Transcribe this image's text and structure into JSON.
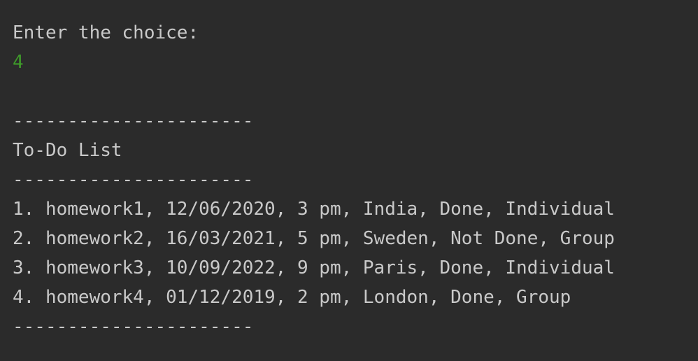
{
  "prompt": "Enter the choice:",
  "user_input": "4",
  "separator": "----------------------",
  "list_title": "To-Do List",
  "items": [
    "1. homework1, 12/06/2020, 3 pm, India, Done, Individual",
    "2. homework2, 16/03/2021, 5 pm, Sweden, Not Done, Group",
    "3. homework3, 10/09/2022, 9 pm, Paris, Done, Individual",
    "4. homework4, 01/12/2019, 2 pm, London, Done, Group"
  ],
  "colors": {
    "background": "#2b2b2b",
    "text": "#c9c9c9",
    "input": "#3f9b2a"
  }
}
